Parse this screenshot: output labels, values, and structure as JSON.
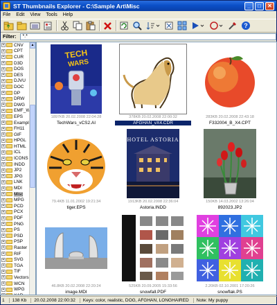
{
  "window": {
    "title": "ST Thumbnails Explorer - C:\\Sample Art\\Misc"
  },
  "menu": [
    "File",
    "Edit",
    "View",
    "Tools",
    "Help"
  ],
  "filter": {
    "label": "Filter:",
    "value": "*.*"
  },
  "tree": {
    "items": [
      "CNV",
      "CPT",
      "CUR",
      "D3D",
      "DOS",
      "DES",
      "DJVU",
      "DOC",
      "DP",
      "DRW",
      "DWG",
      "EMF_WI",
      "EPS",
      "Example",
      "FH11",
      "GIF",
      "HPGL",
      "HTML",
      "ICL",
      "ICONS",
      "INDD",
      "JP2",
      "JPG",
      "LNK",
      "MDI",
      "Misc",
      "MPG",
      "PCD",
      "PCX",
      "PDF",
      "PNG",
      "PS",
      "PSD",
      "PSP",
      "Raster",
      "RIF",
      "SVG",
      "TGA",
      "TIF",
      "Vectors",
      "WCN",
      "WPG",
      "XAR"
    ],
    "selected": "Misc"
  },
  "thumbnails": [
    {
      "meta": "1897KB  20.02.2008 22:04:28",
      "name": "TechWars_vCS2.AI",
      "icon": "techwars-poster-image"
    },
    {
      "meta": "378KB  20.02.2008 22:00:32",
      "name": "AFGHAN_vX4.CDR",
      "icon": "afghan-hound-image",
      "selected": true
    },
    {
      "meta": "283KB  20.02.2008 22:43:18",
      "name": "F332004_B_X4.CPT",
      "icon": "peach-image"
    },
    {
      "meta": "79.4KB  11.01.2002 19:21:34",
      "name": "tiger.EPS",
      "icon": "tiger-image"
    },
    {
      "meta": "1913KB  20.02.2008 22:36:04",
      "name": "Astoria.INDD",
      "icon": "hotel-astoria-image"
    },
    {
      "meta": "150KB  14.03.2002 13:26:04",
      "name": "892023.JP2",
      "icon": "red-tulips-image"
    },
    {
      "meta": "46.8KB  20.02.2008 22:20:24",
      "name": "image.MDI",
      "icon": "city-hall-image"
    },
    {
      "meta": "525KB  20.09.2005 15:33:56",
      "name": "snowfall.PDF",
      "icon": "pdf-pages-image"
    },
    {
      "meta": "2.20KB  02.10.2001 17:20:26",
      "name": "snowflak.PS",
      "icon": "snowflake-grid-image"
    }
  ],
  "status": {
    "count": "1",
    "size": "138 Kb",
    "date": "20.02.2008 22:00:32",
    "keys": "Keys: color, realistic, DOG, AFGHAN, LONGHAIRED",
    "note": "Note: My puppy"
  }
}
